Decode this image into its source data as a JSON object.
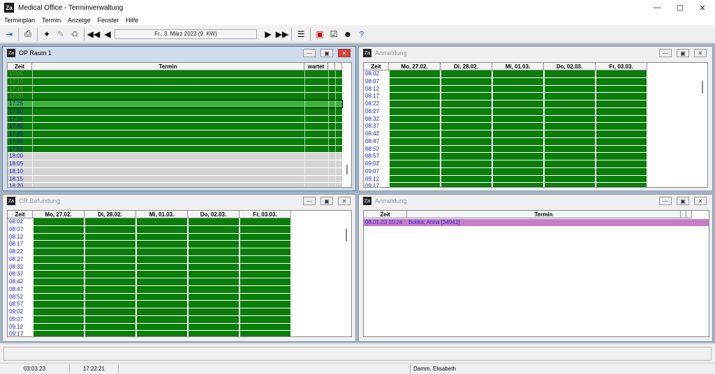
{
  "app": {
    "title": "Medical Office - Terminverwaltung",
    "icon_text": "Za"
  },
  "menu": [
    "Terminplan",
    "Termin",
    "Anzeige",
    "Fenster",
    "Hilfe"
  ],
  "toolbar": {
    "date_label": "Fr., 3. März 2023 (9. KW)"
  },
  "windows": {
    "op": {
      "title": "OP Raum 1",
      "headers": {
        "zeit": "Zeit",
        "termin": "Termin",
        "wartet": "wartet"
      },
      "times_dim": [
        "17:05",
        "17:10",
        "17:15",
        "17:20"
      ],
      "times": [
        "17:25",
        "17:30",
        "17:35",
        "17:40",
        "17:45",
        "17:50",
        "17:55",
        "18:00",
        "18:05",
        "18:10",
        "18:15",
        "18:20"
      ],
      "selected_time": "17:25"
    },
    "anm1": {
      "title": "Anmeldung",
      "headers": {
        "zeit": "Zeit",
        "days": [
          "Mo, 27.02.",
          "Di, 28.02.",
          "Mi, 01.03.",
          "Do, 02.03.",
          "Fr, 03.03."
        ]
      },
      "times": [
        "08:02",
        "08:07",
        "08:12",
        "08:17",
        "08:22",
        "08:27",
        "08:32",
        "08:37",
        "08:42",
        "08:47",
        "08:52",
        "08:57",
        "09:02",
        "09:07",
        "09:12",
        "09:17"
      ]
    },
    "cr": {
      "title": "CR Befundung",
      "headers": {
        "zeit": "Zeit",
        "days": [
          "Mo, 27.02.",
          "Di, 28.02.",
          "Mi, 01.03.",
          "Do, 02.03.",
          "Fr, 03.03."
        ]
      },
      "times": [
        "08:02",
        "08:07",
        "08:12",
        "08:17",
        "08:22",
        "08:27",
        "08:32",
        "08:37",
        "08:42",
        "08:47",
        "08:52",
        "08:57",
        "09:02",
        "09:07",
        "09:12",
        "09:17"
      ]
    },
    "anm2": {
      "title": "Anmeldung",
      "headers": {
        "zeit": "Zeit",
        "termin": "Termin"
      },
      "rows": [
        {
          "zeit": "08.01.23 10:24",
          "termin": "Bolika, Anna [34941]"
        }
      ]
    }
  },
  "status": {
    "date": "03.03.23",
    "time": "17:22:21",
    "user": "Damm, Elisabeth"
  },
  "colors": {
    "slot_green": "#0a7d0a",
    "slot_grey": "#d4d4d4",
    "appt_purple": "#c97ac9",
    "time_blue": "#1a1aa8"
  }
}
